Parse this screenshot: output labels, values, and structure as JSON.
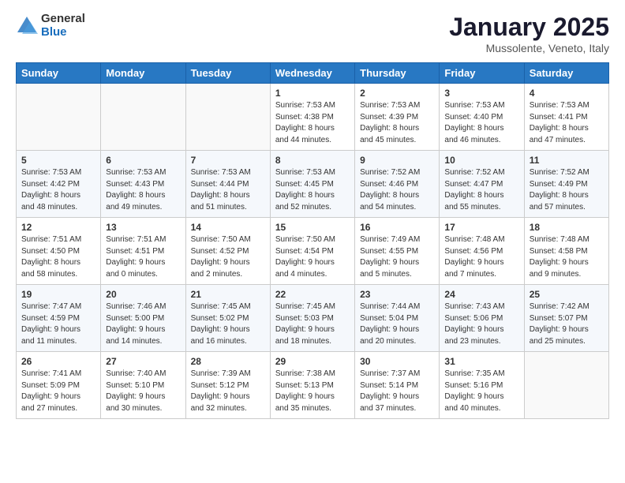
{
  "logo": {
    "general": "General",
    "blue": "Blue"
  },
  "title": "January 2025",
  "subtitle": "Mussolente, Veneto, Italy",
  "weekdays": [
    "Sunday",
    "Monday",
    "Tuesday",
    "Wednesday",
    "Thursday",
    "Friday",
    "Saturday"
  ],
  "weeks": [
    [
      {
        "day": "",
        "sunrise": "",
        "sunset": "",
        "daylight": ""
      },
      {
        "day": "",
        "sunrise": "",
        "sunset": "",
        "daylight": ""
      },
      {
        "day": "",
        "sunrise": "",
        "sunset": "",
        "daylight": ""
      },
      {
        "day": "1",
        "sunrise": "Sunrise: 7:53 AM",
        "sunset": "Sunset: 4:38 PM",
        "daylight": "Daylight: 8 hours and 44 minutes."
      },
      {
        "day": "2",
        "sunrise": "Sunrise: 7:53 AM",
        "sunset": "Sunset: 4:39 PM",
        "daylight": "Daylight: 8 hours and 45 minutes."
      },
      {
        "day": "3",
        "sunrise": "Sunrise: 7:53 AM",
        "sunset": "Sunset: 4:40 PM",
        "daylight": "Daylight: 8 hours and 46 minutes."
      },
      {
        "day": "4",
        "sunrise": "Sunrise: 7:53 AM",
        "sunset": "Sunset: 4:41 PM",
        "daylight": "Daylight: 8 hours and 47 minutes."
      }
    ],
    [
      {
        "day": "5",
        "sunrise": "Sunrise: 7:53 AM",
        "sunset": "Sunset: 4:42 PM",
        "daylight": "Daylight: 8 hours and 48 minutes."
      },
      {
        "day": "6",
        "sunrise": "Sunrise: 7:53 AM",
        "sunset": "Sunset: 4:43 PM",
        "daylight": "Daylight: 8 hours and 49 minutes."
      },
      {
        "day": "7",
        "sunrise": "Sunrise: 7:53 AM",
        "sunset": "Sunset: 4:44 PM",
        "daylight": "Daylight: 8 hours and 51 minutes."
      },
      {
        "day": "8",
        "sunrise": "Sunrise: 7:53 AM",
        "sunset": "Sunset: 4:45 PM",
        "daylight": "Daylight: 8 hours and 52 minutes."
      },
      {
        "day": "9",
        "sunrise": "Sunrise: 7:52 AM",
        "sunset": "Sunset: 4:46 PM",
        "daylight": "Daylight: 8 hours and 54 minutes."
      },
      {
        "day": "10",
        "sunrise": "Sunrise: 7:52 AM",
        "sunset": "Sunset: 4:47 PM",
        "daylight": "Daylight: 8 hours and 55 minutes."
      },
      {
        "day": "11",
        "sunrise": "Sunrise: 7:52 AM",
        "sunset": "Sunset: 4:49 PM",
        "daylight": "Daylight: 8 hours and 57 minutes."
      }
    ],
    [
      {
        "day": "12",
        "sunrise": "Sunrise: 7:51 AM",
        "sunset": "Sunset: 4:50 PM",
        "daylight": "Daylight: 8 hours and 58 minutes."
      },
      {
        "day": "13",
        "sunrise": "Sunrise: 7:51 AM",
        "sunset": "Sunset: 4:51 PM",
        "daylight": "Daylight: 9 hours and 0 minutes."
      },
      {
        "day": "14",
        "sunrise": "Sunrise: 7:50 AM",
        "sunset": "Sunset: 4:52 PM",
        "daylight": "Daylight: 9 hours and 2 minutes."
      },
      {
        "day": "15",
        "sunrise": "Sunrise: 7:50 AM",
        "sunset": "Sunset: 4:54 PM",
        "daylight": "Daylight: 9 hours and 4 minutes."
      },
      {
        "day": "16",
        "sunrise": "Sunrise: 7:49 AM",
        "sunset": "Sunset: 4:55 PM",
        "daylight": "Daylight: 9 hours and 5 minutes."
      },
      {
        "day": "17",
        "sunrise": "Sunrise: 7:48 AM",
        "sunset": "Sunset: 4:56 PM",
        "daylight": "Daylight: 9 hours and 7 minutes."
      },
      {
        "day": "18",
        "sunrise": "Sunrise: 7:48 AM",
        "sunset": "Sunset: 4:58 PM",
        "daylight": "Daylight: 9 hours and 9 minutes."
      }
    ],
    [
      {
        "day": "19",
        "sunrise": "Sunrise: 7:47 AM",
        "sunset": "Sunset: 4:59 PM",
        "daylight": "Daylight: 9 hours and 11 minutes."
      },
      {
        "day": "20",
        "sunrise": "Sunrise: 7:46 AM",
        "sunset": "Sunset: 5:00 PM",
        "daylight": "Daylight: 9 hours and 14 minutes."
      },
      {
        "day": "21",
        "sunrise": "Sunrise: 7:45 AM",
        "sunset": "Sunset: 5:02 PM",
        "daylight": "Daylight: 9 hours and 16 minutes."
      },
      {
        "day": "22",
        "sunrise": "Sunrise: 7:45 AM",
        "sunset": "Sunset: 5:03 PM",
        "daylight": "Daylight: 9 hours and 18 minutes."
      },
      {
        "day": "23",
        "sunrise": "Sunrise: 7:44 AM",
        "sunset": "Sunset: 5:04 PM",
        "daylight": "Daylight: 9 hours and 20 minutes."
      },
      {
        "day": "24",
        "sunrise": "Sunrise: 7:43 AM",
        "sunset": "Sunset: 5:06 PM",
        "daylight": "Daylight: 9 hours and 23 minutes."
      },
      {
        "day": "25",
        "sunrise": "Sunrise: 7:42 AM",
        "sunset": "Sunset: 5:07 PM",
        "daylight": "Daylight: 9 hours and 25 minutes."
      }
    ],
    [
      {
        "day": "26",
        "sunrise": "Sunrise: 7:41 AM",
        "sunset": "Sunset: 5:09 PM",
        "daylight": "Daylight: 9 hours and 27 minutes."
      },
      {
        "day": "27",
        "sunrise": "Sunrise: 7:40 AM",
        "sunset": "Sunset: 5:10 PM",
        "daylight": "Daylight: 9 hours and 30 minutes."
      },
      {
        "day": "28",
        "sunrise": "Sunrise: 7:39 AM",
        "sunset": "Sunset: 5:12 PM",
        "daylight": "Daylight: 9 hours and 32 minutes."
      },
      {
        "day": "29",
        "sunrise": "Sunrise: 7:38 AM",
        "sunset": "Sunset: 5:13 PM",
        "daylight": "Daylight: 9 hours and 35 minutes."
      },
      {
        "day": "30",
        "sunrise": "Sunrise: 7:37 AM",
        "sunset": "Sunset: 5:14 PM",
        "daylight": "Daylight: 9 hours and 37 minutes."
      },
      {
        "day": "31",
        "sunrise": "Sunrise: 7:35 AM",
        "sunset": "Sunset: 5:16 PM",
        "daylight": "Daylight: 9 hours and 40 minutes."
      },
      {
        "day": "",
        "sunrise": "",
        "sunset": "",
        "daylight": ""
      }
    ]
  ]
}
